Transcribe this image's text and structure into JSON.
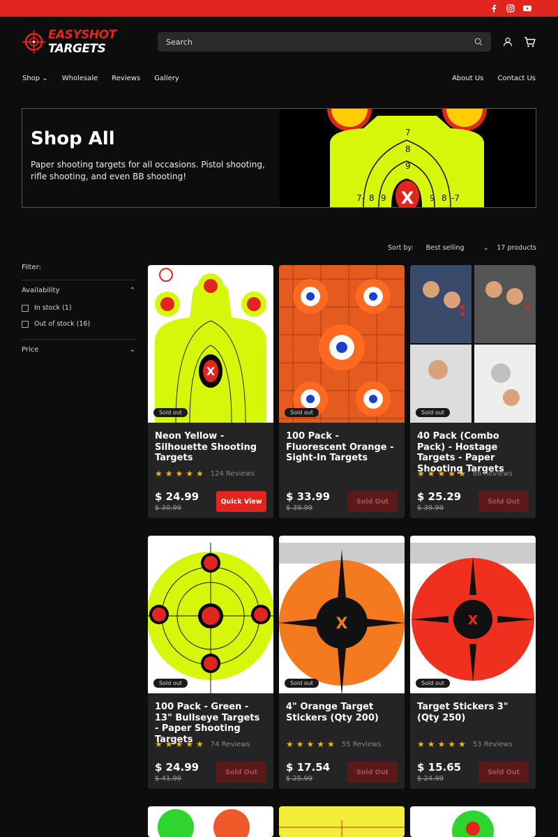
{
  "brand": {
    "name_a": "EASYSHOT",
    "name_b": " TARGETS",
    "accent": "#e0261f"
  },
  "social": [
    "facebook-icon",
    "instagram-icon",
    "youtube-icon"
  ],
  "search": {
    "placeholder": "Search"
  },
  "nav": {
    "left": [
      "Shop",
      "Wholesale",
      "Reviews",
      "Gallery"
    ],
    "right": [
      "About Us",
      "Contact Us"
    ]
  },
  "hero": {
    "title": "Shop All",
    "description": "Paper shooting targets for all occasions. Pistol shooting, rifle shooting, and even BB shooting!"
  },
  "toolbar": {
    "sort_label": "Sort by:",
    "sort_value": "Best selling",
    "count": "17 products"
  },
  "filter": {
    "title": "Filter:",
    "availability": "Availability",
    "in_stock": "In stock (1)",
    "out_of_stock": "Out of stock (16)",
    "price": "Price"
  },
  "products": [
    {
      "title": "Neon Yellow - Silhouette Shooting Targets",
      "reviews": "124 Reviews",
      "price": "$ 24.99",
      "old": "$ 30.99",
      "button": "Quick View",
      "badge": "Sold out"
    },
    {
      "title": "100 Pack - Fluorescent Orange - Sight-In Targets",
      "reviews": "",
      "price": "$ 33.99",
      "old": "$ 39.99",
      "button": "Sold Out",
      "badge": "Sold out"
    },
    {
      "title": "40 Pack (Combo Pack) - Hostage Targets - Paper Shooting Targets",
      "reviews": "86 Reviews",
      "price": "$ 25.29",
      "old": "$ 39.99",
      "button": "Sold Out",
      "badge": "Sold out"
    },
    {
      "title": "100 Pack - Green - 13\" Bullseye Targets - Paper Shooting Targets",
      "reviews": "74 Reviews",
      "price": "$ 24.99",
      "old": "$ 41.99",
      "button": "Sold Out",
      "badge": "Sold out"
    },
    {
      "title": "4\" Orange Target Stickers (Qty 200)",
      "reviews": "55 Reviews",
      "price": "$ 17.54",
      "old": "$ 25.99",
      "button": "Sold Out",
      "badge": "Sold out"
    },
    {
      "title": "Target Stickers 3\" (Qty 250)",
      "reviews": "53 Reviews",
      "price": "$ 15.65",
      "old": "$ 24.99",
      "button": "Sold Out",
      "badge": "Sold out"
    }
  ],
  "stars": "★★★★★"
}
